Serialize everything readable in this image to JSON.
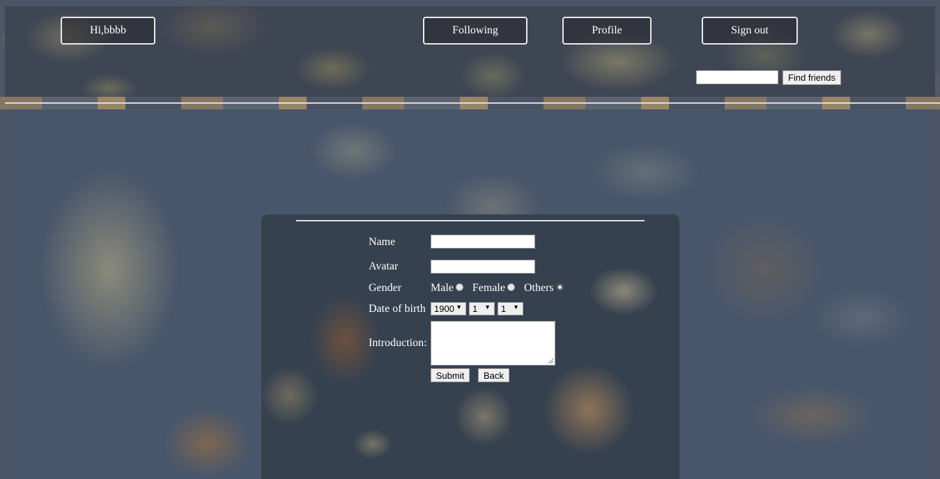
{
  "header": {
    "greeting": "Hi,bbbb",
    "nav": {
      "following": "Following",
      "profile": "Profile",
      "sign_out": "Sign out"
    },
    "search": {
      "value": "",
      "button_label": "Find friends"
    }
  },
  "form": {
    "name_label": "Name",
    "name_value": "",
    "avatar_label": "Avatar",
    "avatar_value": "",
    "gender_label": "Gender",
    "gender_options": [
      "Male",
      "Female",
      "Others"
    ],
    "gender_selected": "Others",
    "dob_label": "Date of birth",
    "dob": {
      "year": "1900",
      "month": "1",
      "day": "1"
    },
    "intro_label": "Introduction:",
    "intro_value": "",
    "submit_label": "Submit",
    "back_label": "Back"
  }
}
